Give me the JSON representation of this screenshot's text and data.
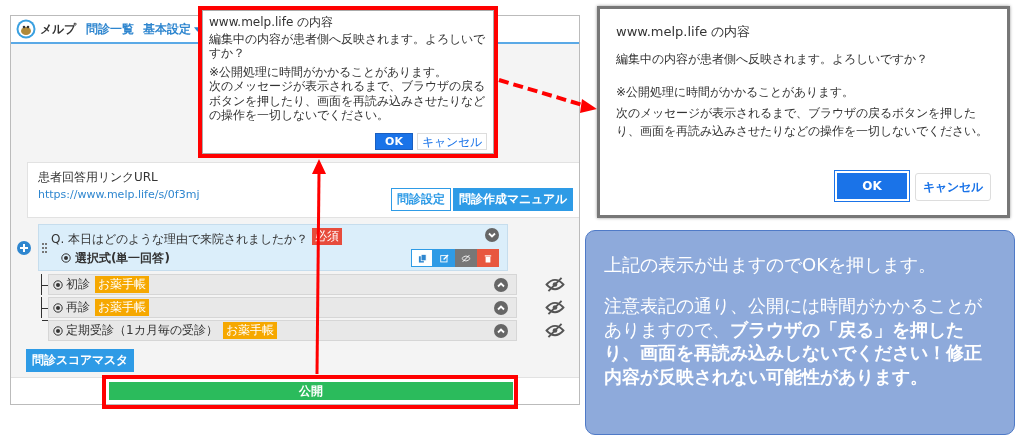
{
  "app": {
    "logo_text": "メルプ",
    "nav": [
      {
        "label": "問診一覧",
        "dropdown": false
      },
      {
        "label": "基本設定",
        "dropdown": true
      }
    ],
    "link_card": {
      "label": "患者回答用リンクURL",
      "url": "https://www.melp.life/s/0f3mj",
      "buttons": [
        {
          "label": "問診設定",
          "kind": "outline"
        },
        {
          "label": "問診作成マニュアル",
          "kind": "primary"
        }
      ]
    },
    "question": {
      "prefix": "Q.",
      "text": "本日はどのような理由で来院されましたか？",
      "badge": "必須",
      "answer_type": "選択式(単一回答)"
    },
    "options": [
      {
        "label": "初診",
        "tag": "お薬手帳"
      },
      {
        "label": "再診",
        "tag": "お薬手帳"
      },
      {
        "label": "定期受診（1カ月毎の受診）",
        "tag": "お薬手帳"
      }
    ],
    "score_button": "問診スコアマスタ",
    "publish_button": "公開"
  },
  "small_dialog": {
    "title": "www.melp.life の内容",
    "message": "編集中の内容が患者側へ反映されます。よろしいですか？",
    "notes": [
      "※公開処理に時間がかかることがあります。",
      "次のメッセージが表示されるまで、ブラウザの戻るボタンを押したり、画面を再読み込みさせたりなどの操作を一切しないでください。"
    ],
    "ok": "OK",
    "cancel": "キャンセル"
  },
  "large_dialog": {
    "title": "www.melp.life の内容",
    "message": "編集中の内容が患者側へ反映されます。よろしいですか？",
    "notes": [
      "※公開処理に時間がかかることがあります。",
      "次のメッセージが表示されるまで、ブラウザの戻るボタンを押したり、画面を再読み込みさせたりなどの操作を一切しないでください。"
    ],
    "ok": "OK",
    "cancel": "キャンセル"
  },
  "callout": {
    "paragraphs": [
      "上記の表示が出ますのでOKを押します。",
      "注意表記の通り、公開には時間がかかることがありますので、**ブラウザの「戻る」を押したり、画面を再読み込みしないでください！修正内容が反映されない可能性があります。**"
    ]
  }
}
